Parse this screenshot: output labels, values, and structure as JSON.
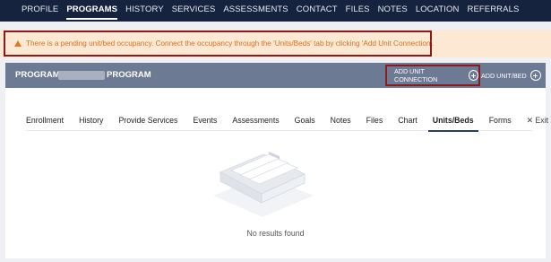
{
  "topnav": {
    "items": [
      "PROFILE",
      "PROGRAMS",
      "HISTORY",
      "SERVICES",
      "ASSESSMENTS",
      "CONTACT",
      "FILES",
      "NOTES",
      "LOCATION",
      "REFERRALS"
    ],
    "active": "PROGRAMS"
  },
  "warning": {
    "text": "There is a pending unit/bed occupancy. Connect the occupancy through the 'Units/Beds' tab by clicking 'Add Unit Connection'."
  },
  "program_header": {
    "label": "PROGRAM:",
    "suffix": "PROGRAM",
    "add_unit_connection": "ADD UNIT CONNECTION",
    "add_unit_bed": "ADD UNIT/BED"
  },
  "tabs": {
    "items": [
      "Enrollment",
      "History",
      "Provide Services",
      "Events",
      "Assessments",
      "Goals",
      "Notes",
      "Files",
      "Chart",
      "Units/Beds",
      "Forms"
    ],
    "active": "Units/Beds",
    "exit": "✕ Exit"
  },
  "empty_state": {
    "text": "No results found"
  },
  "colors": {
    "nav_bg": "#16233f",
    "header_bg": "#6c7a94",
    "warning_bg": "#fde9d3",
    "warning_text": "#d2711d",
    "highlight_border": "#8b1a1f"
  }
}
